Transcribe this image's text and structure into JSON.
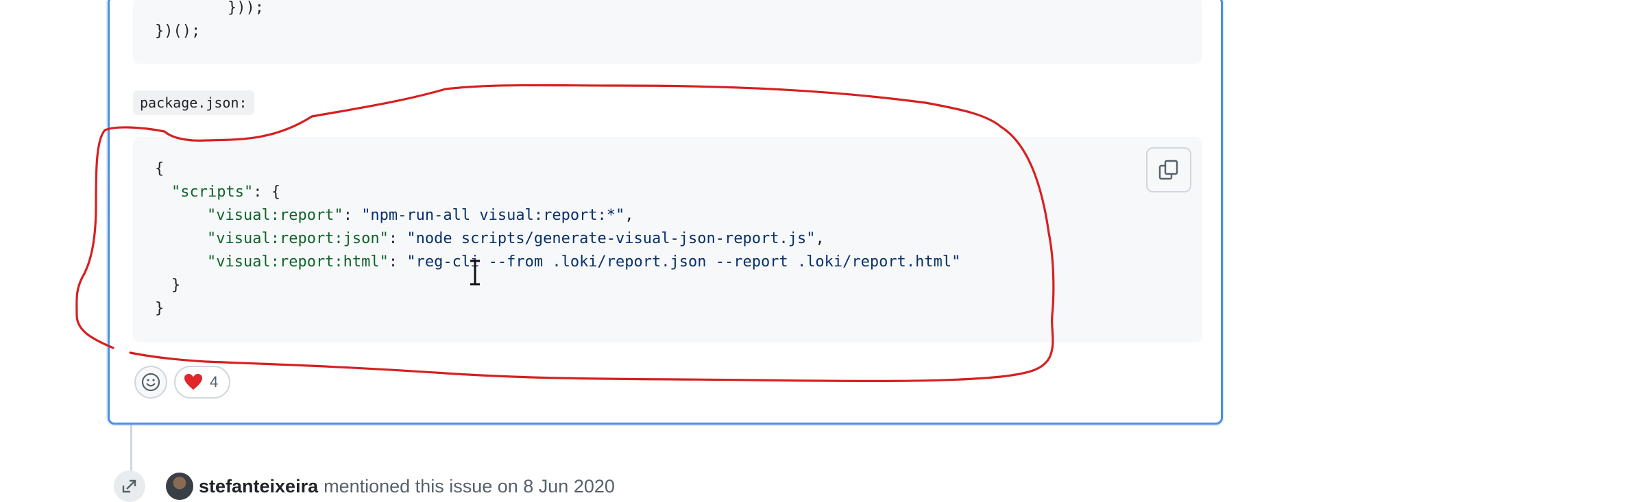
{
  "top_code": {
    "lines": [
      "        }));",
      "})();"
    ]
  },
  "filename": "package.json:",
  "main_code": {
    "line0": "{",
    "line1_key": "\"scripts\"",
    "line1_rest": ": {",
    "line2_key": "\"visual:report\"",
    "line2_str": "\"npm-run-all visual:report:*\"",
    "line3_key": "\"visual:report:json\"",
    "line3_str": "\"node scripts/generate-visual-json-report.js\"",
    "line4_key": "\"visual:report:html\"",
    "line4_str": "\"reg-cli --from .loki/report.json --report .loki/report.html\"",
    "line5": "}",
    "line6": "}",
    "separator": ": ",
    "comma": ","
  },
  "reactions": {
    "heart_count": "4"
  },
  "event": {
    "user": "stefanteixeira",
    "text": "mentioned this issue on 8 Jun 2020"
  },
  "icons": [
    "copy-icon",
    "smiley-icon",
    "heart-icon",
    "cross-reference-icon"
  ],
  "colors": {
    "accent_border": "#4a8fe7",
    "annotation": "#d62020",
    "code_key": "#116329",
    "code_string": "#0a3069"
  }
}
